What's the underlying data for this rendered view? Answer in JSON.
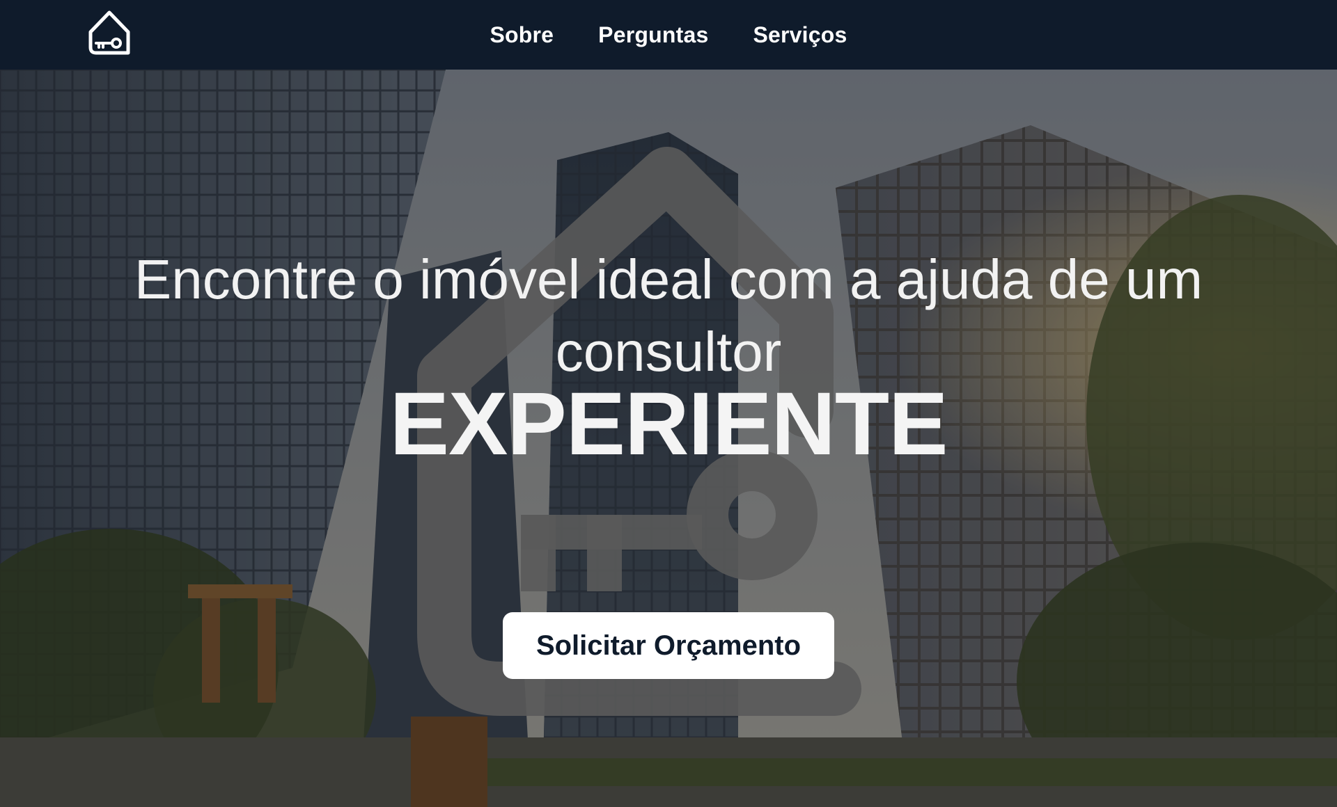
{
  "nav": {
    "logo_icon": "house-key-icon",
    "links": [
      {
        "label": "Sobre"
      },
      {
        "label": "Perguntas"
      },
      {
        "label": "Serviços"
      }
    ]
  },
  "hero": {
    "background": "city-skyscrapers-photo",
    "watermark_icon": "house-key-icon",
    "headline": "Encontre o imóvel ideal com a ajuda de um consultor",
    "highlight": "EXPERIENTE",
    "cta_label": "Solicitar Orçamento"
  },
  "colors": {
    "navbar_bg": "#0f1b2b",
    "button_bg": "#ffffff",
    "button_text": "#0f1b2b",
    "hero_text": "#f2f2f2"
  }
}
